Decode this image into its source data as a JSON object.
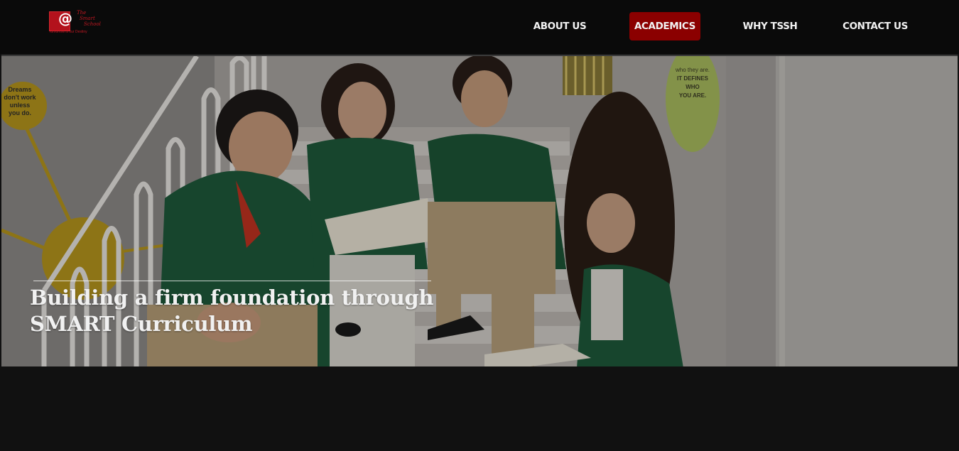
{
  "logo": {
    "script_lines": [
      "The",
      "Smart",
      "School"
    ],
    "tagline": "Tomorrow is our Destiny",
    "symbol": "@"
  },
  "nav": {
    "items": [
      {
        "label": "ABOUT US"
      },
      {
        "label": "ACADEMICS",
        "active": true
      },
      {
        "label": "WHY TSSH"
      },
      {
        "label": "CONTACT US"
      }
    ],
    "active_color": "#8b0000"
  },
  "hero": {
    "title_line1": "Building a firm foundation through",
    "title_line2": "SMART Curriculum",
    "poster_left": [
      "Dreams",
      "don't work",
      "unless",
      "you do."
    ],
    "poster_right": [
      "who they are.",
      "IT DEFINES WHO",
      "YOU ARE."
    ]
  },
  "colors": {
    "background": "#111111",
    "header": "#0a0a0a",
    "blazer_green": "#1f5a3c"
  }
}
